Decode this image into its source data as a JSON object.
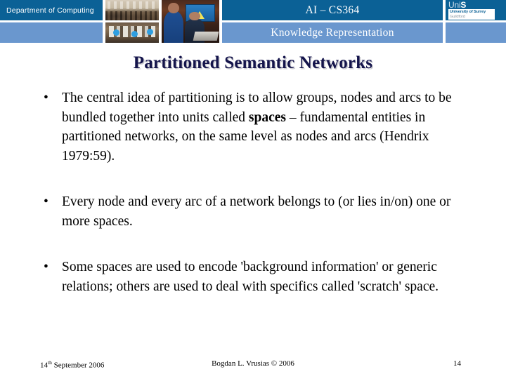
{
  "header": {
    "department_label": "Department of Computing",
    "course_code": "AI – CS364",
    "course_topic": "Knowledge Representation",
    "logo": {
      "wordmark_prefix": "Uni",
      "wordmark_accent": "S",
      "institution": "University of Surrey",
      "location": "Guildford"
    },
    "photos": [
      {
        "name": "lecture-hall-photo"
      },
      {
        "name": "computer-lab-photo"
      },
      {
        "name": "students-laptop-photo"
      }
    ],
    "colors": {
      "dark_blue": "#0B6196",
      "light_blue": "#6A97CE",
      "white": "#FFFFFF"
    }
  },
  "slide": {
    "title": "Partitioned Semantic Networks",
    "title_color": "#14144B",
    "bullets": [
      {
        "marker": "•",
        "parts": [
          {
            "text": "The central idea of partitioning is to allow groups, nodes and arcs to be bundled together into units called ",
            "bold": false
          },
          {
            "text": "spaces",
            "bold": true
          },
          {
            "text": " – fundamental entities in partitioned networks, on the same level as nodes and arcs (Hendrix 1979:59).",
            "bold": false
          }
        ]
      },
      {
        "marker": "•",
        "parts": [
          {
            "text": "Every node and every arc of a network belongs to (or lies in/on) one or more spaces.",
            "bold": false
          }
        ]
      },
      {
        "marker": "•",
        "parts": [
          {
            "text": "Some spaces are used to encode 'background information' or generic relations; others are used to deal with specifics called 'scratch' space.",
            "bold": false
          }
        ]
      }
    ]
  },
  "footer": {
    "date_day": "14",
    "date_ordinal": "th",
    "date_rest": " September 2006",
    "author": "Bogdan L. Vrusias © 2006",
    "page_number": "14"
  }
}
